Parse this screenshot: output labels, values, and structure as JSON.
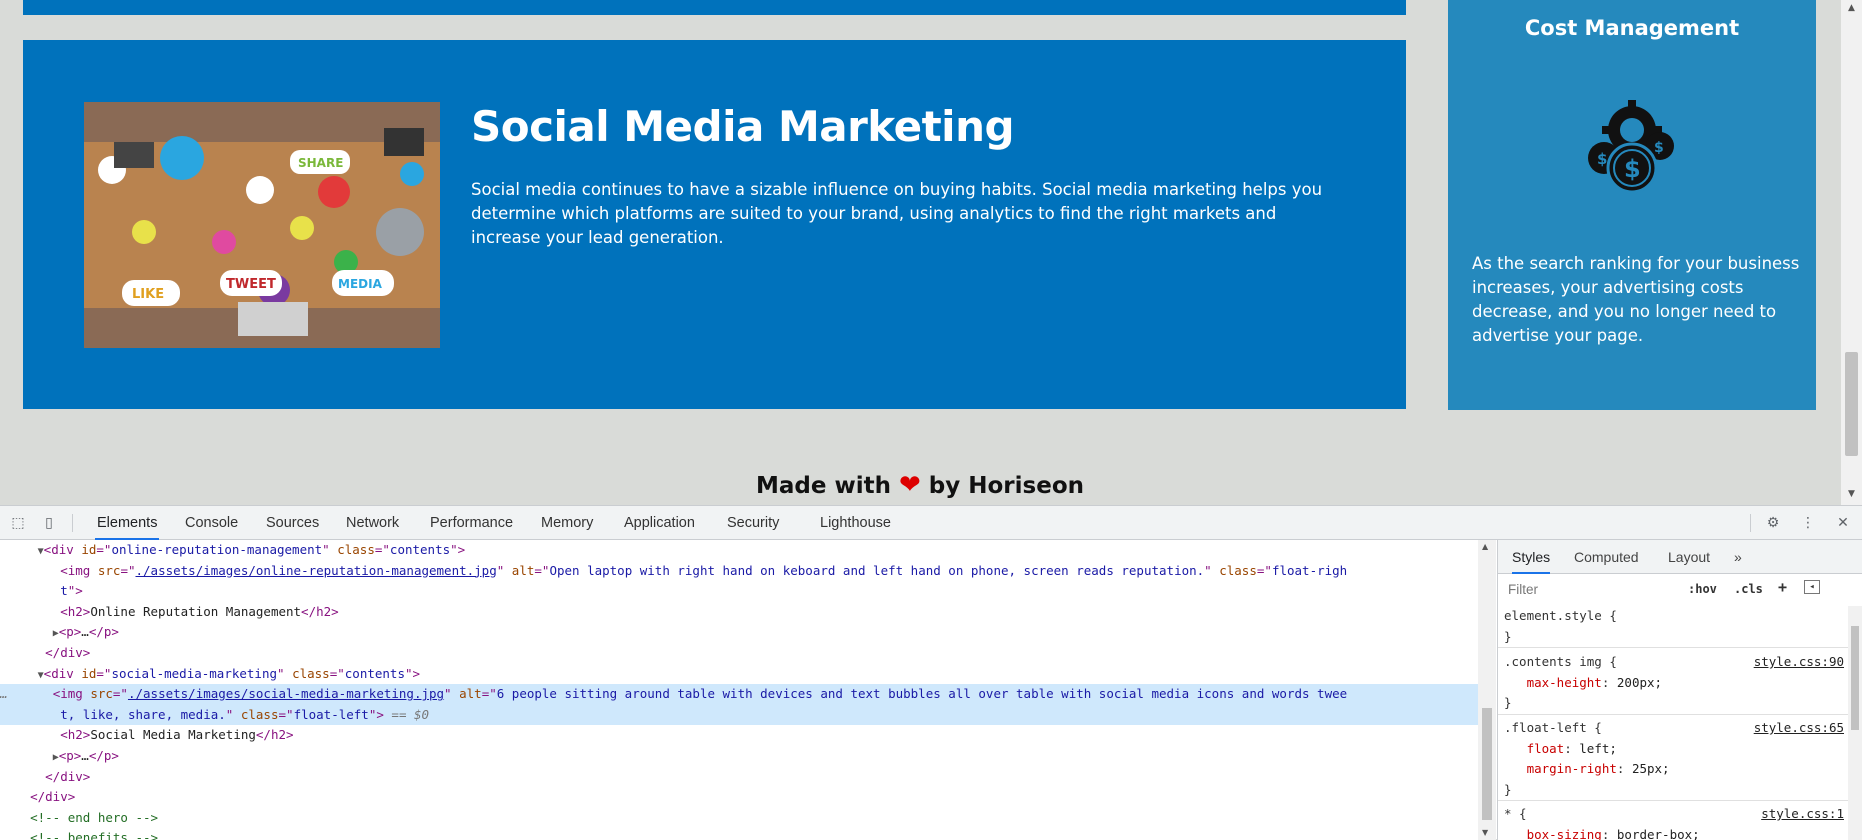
{
  "page": {
    "hero": {
      "title": "Social Media Marketing",
      "text": "Social media continues to have a sizable influence on buying habits. Social media marketing helps you determine which platforms are suited to your brand, using analytics to find the right markets and increase your lead generation.",
      "image_alt": "6 people sitting around table with devices and text bubbles all over table with social media icons and words tweet, like, share, media.",
      "image_words": [
        "SHARE",
        "TWEET",
        "LIKE",
        "MEDIA"
      ]
    },
    "aside": {
      "title": "Cost Management",
      "icon": "coins-gear-icon",
      "text": "As the search ranking for your business increases, your advertising costs decrease, and you no longer need to advertise your page."
    },
    "footer": {
      "before": "Made with",
      "heart": "❤",
      "after": "by Horiseon"
    },
    "colors": {
      "card_blue": "#0072bc",
      "aside_blue": "#2589bd",
      "page_bg": "#d9dbd8"
    }
  },
  "devtools": {
    "tabs": [
      "Elements",
      "Console",
      "Sources",
      "Network",
      "Performance",
      "Memory",
      "Application",
      "Security",
      "Lighthouse"
    ],
    "active_tab": "Elements",
    "styles_tabs": [
      "Styles",
      "Computed",
      "Layout"
    ],
    "more_tabs": "»",
    "filter_placeholder": "Filter",
    "hov_label": ":hov",
    "cls_label": ".cls",
    "plus_label": "+",
    "selected_suffix": "== $0",
    "rules": [
      {
        "selector": "element.style {",
        "source": "",
        "props": [],
        "close": "}"
      },
      {
        "selector": ".contents img {",
        "source": "style.css:90",
        "props": [
          {
            "name": "max-height",
            "value": "200px;"
          }
        ],
        "close": "}"
      },
      {
        "selector": ".float-left {",
        "source": "style.css:65",
        "props": [
          {
            "name": "float",
            "value": "left;"
          },
          {
            "name": "margin-right",
            "value": "25px;"
          }
        ],
        "close": "}"
      },
      {
        "selector": "* {",
        "source": "style.css:1",
        "props": [
          {
            "name": "box-sizing",
            "value": "border-box;"
          }
        ],
        "close": ""
      }
    ]
  }
}
